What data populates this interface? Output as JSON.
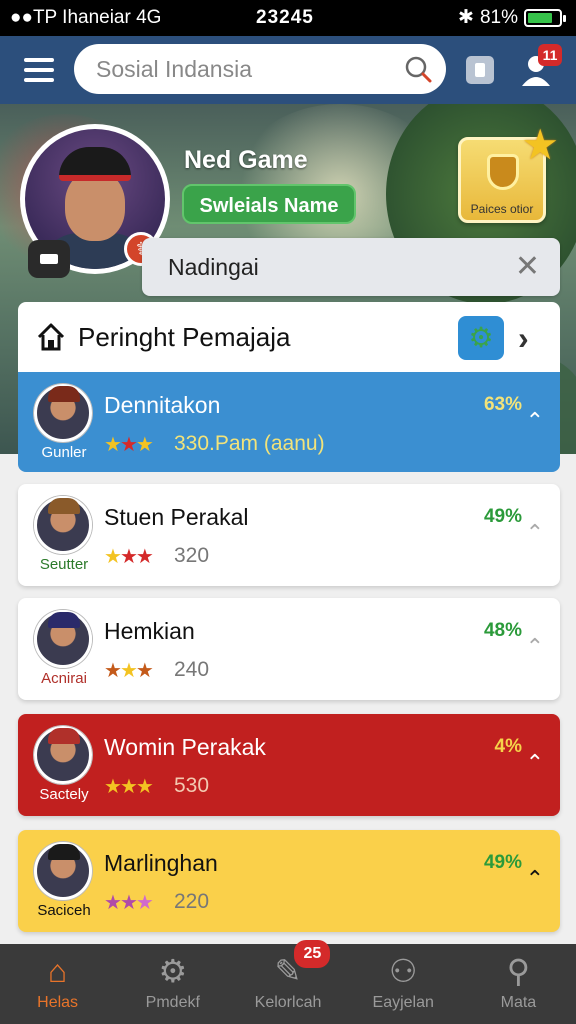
{
  "status_bar": {
    "carrier": "●●TP Ihaneiar  4G",
    "time": "23245",
    "battery": "81%",
    "battery_level": 0.81
  },
  "top_bar": {
    "search_placeholder": "Sosial Indansia",
    "notification_count": "11"
  },
  "profile": {
    "game_title": "Ned Game",
    "name_button": "Swleials Name",
    "pass_badge_label": "Paices otior",
    "info_field_value": "Nadingai"
  },
  "list": {
    "title": "Peringht Pemajaja",
    "rows": [
      {
        "name": "Dennitakon",
        "sub": "Gunler",
        "stars": 3,
        "score": "330.Pam (aanu)",
        "percent": "63%",
        "bg": "#3b8fd1",
        "text": "#ffffff",
        "pct_color": "#f2e37a"
      },
      {
        "name": "Stuen Perakal",
        "sub": "Seutter",
        "stars": 3,
        "score": "320",
        "percent": "49%",
        "bg": "#ffffff",
        "text": "#111111",
        "pct_color": "#2b9a3a"
      },
      {
        "name": "Hemkian",
        "sub": "Acnirai",
        "stars": 3,
        "score": "240",
        "percent": "48%",
        "bg": "#ffffff",
        "text": "#111111",
        "pct_color": "#2b9a3a"
      },
      {
        "name": "Womin Perakak",
        "sub": "Sactely",
        "stars": 3,
        "score": "530",
        "percent": "4%",
        "bg": "#c1201f",
        "text": "#ffffff",
        "pct_color": "#f5d34a"
      },
      {
        "name": "Marlinghan",
        "sub": "Saciceh",
        "stars": 3,
        "score": "220",
        "percent": "49%",
        "bg": "#fad04a",
        "text": "#111111",
        "pct_color": "#2b9a3a"
      }
    ]
  },
  "bottom_nav": [
    {
      "label": "Helas",
      "icon": "home-icon",
      "active": true
    },
    {
      "label": "Pmdekf",
      "icon": "gear-icon",
      "active": false
    },
    {
      "label": "Kelorlcah",
      "icon": "edit-icon",
      "active": false,
      "badge": "25"
    },
    {
      "label": "Eayjelan",
      "icon": "user-group-icon",
      "active": false
    },
    {
      "label": "Mata",
      "icon": "search-icon",
      "active": false
    }
  ]
}
